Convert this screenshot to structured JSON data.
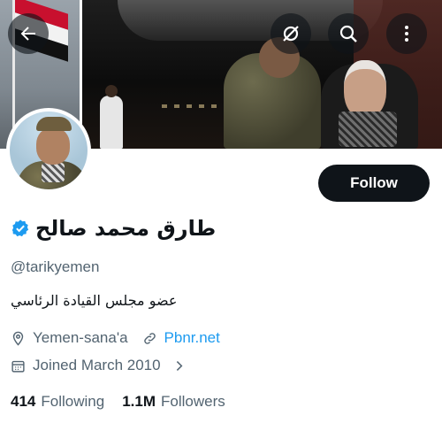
{
  "header": {
    "back_icon": "arrow-left-icon",
    "favicon_icon": "grok-swirl-icon",
    "search_icon": "search-icon",
    "more_icon": "more-vertical-icon"
  },
  "profile": {
    "display_name": "طارق محمد صالح",
    "verified": true,
    "handle": "@tarikyemen",
    "bio": "عضو مجلس القيادة الرئاسي",
    "location": "Yemen-sana'a",
    "website": "Pbnr.net",
    "joined": "Joined March 2010",
    "following_count": "414",
    "following_label": "Following",
    "followers_count": "1.1M",
    "followers_label": "Followers"
  },
  "actions": {
    "follow_label": "Follow"
  },
  "colors": {
    "accent": "#1d9bf0",
    "text_primary": "#0f1419",
    "text_secondary": "#536471",
    "button_dark": "#0f1419"
  }
}
